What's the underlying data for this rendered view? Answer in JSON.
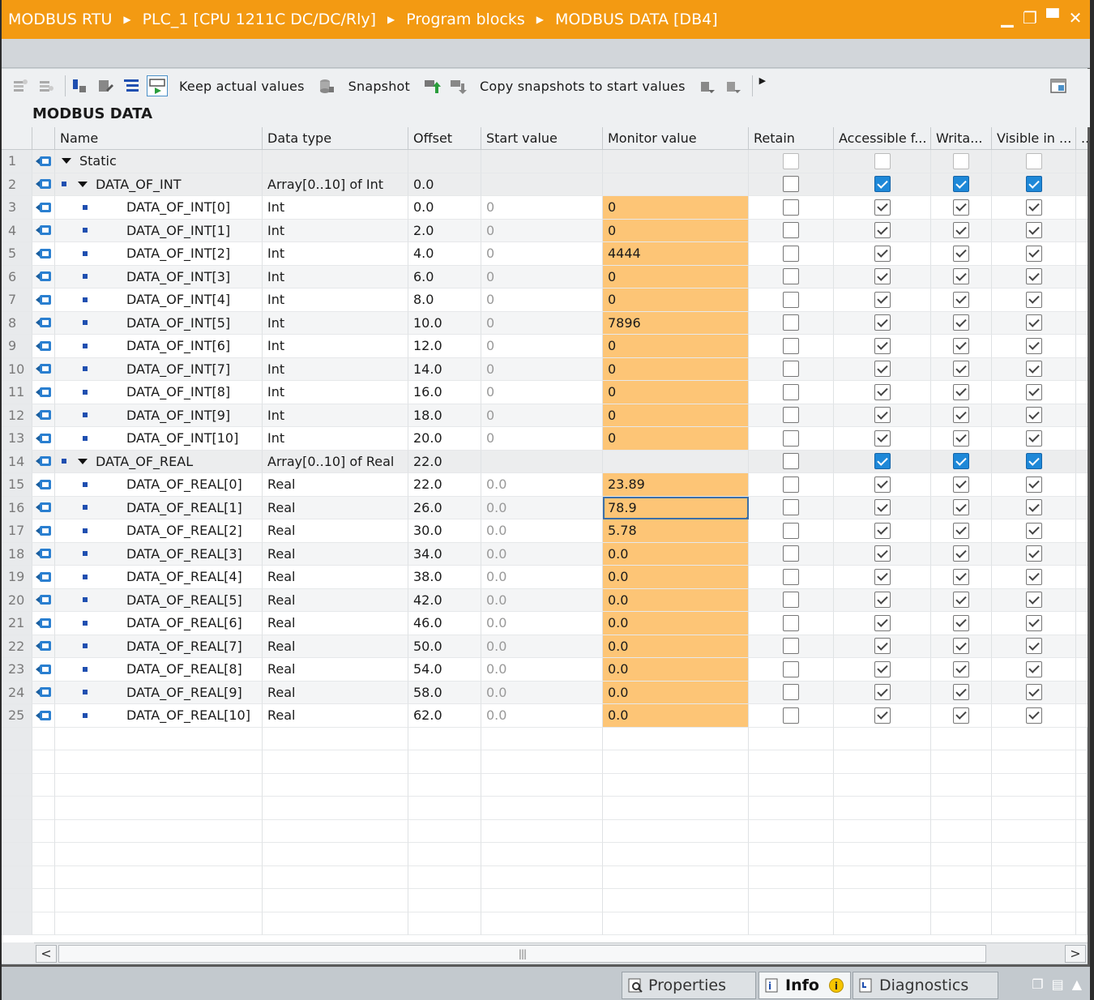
{
  "titlebar": {
    "crumbs": [
      "MODBUS RTU",
      "PLC_1 [CPU 1211C DC/DC/Rly]",
      "Program blocks",
      "MODBUS DATA [DB4]"
    ]
  },
  "toolbar": {
    "keep_actual": "Keep actual values",
    "snapshot": "Snapshot",
    "copy_snapshots": "Copy snapshots to start values"
  },
  "block_title": "MODBUS DATA",
  "columns": [
    "Name",
    "Data type",
    "Offset",
    "Start value",
    "Monitor value",
    "Retain",
    "Accessible f...",
    "Writa...",
    "Visible in ..."
  ],
  "rows": [
    {
      "n": "1",
      "name": "Static",
      "type": "",
      "offset": "",
      "start": "",
      "monitor": ""
    },
    {
      "n": "2",
      "name": "DATA_OF_INT",
      "type": "Array[0..10] of Int",
      "offset": "0.0",
      "start": "",
      "monitor": ""
    },
    {
      "n": "3",
      "name": "DATA_OF_INT[0]",
      "type": "Int",
      "offset": "0.0",
      "start": "0",
      "monitor": "0"
    },
    {
      "n": "4",
      "name": "DATA_OF_INT[1]",
      "type": "Int",
      "offset": "2.0",
      "start": "0",
      "monitor": "0"
    },
    {
      "n": "5",
      "name": "DATA_OF_INT[2]",
      "type": "Int",
      "offset": "4.0",
      "start": "0",
      "monitor": "4444"
    },
    {
      "n": "6",
      "name": "DATA_OF_INT[3]",
      "type": "Int",
      "offset": "6.0",
      "start": "0",
      "monitor": "0"
    },
    {
      "n": "7",
      "name": "DATA_OF_INT[4]",
      "type": "Int",
      "offset": "8.0",
      "start": "0",
      "monitor": "0"
    },
    {
      "n": "8",
      "name": "DATA_OF_INT[5]",
      "type": "Int",
      "offset": "10.0",
      "start": "0",
      "monitor": "7896"
    },
    {
      "n": "9",
      "name": "DATA_OF_INT[6]",
      "type": "Int",
      "offset": "12.0",
      "start": "0",
      "monitor": "0"
    },
    {
      "n": "10",
      "name": "DATA_OF_INT[7]",
      "type": "Int",
      "offset": "14.0",
      "start": "0",
      "monitor": "0"
    },
    {
      "n": "11",
      "name": "DATA_OF_INT[8]",
      "type": "Int",
      "offset": "16.0",
      "start": "0",
      "monitor": "0"
    },
    {
      "n": "12",
      "name": "DATA_OF_INT[9]",
      "type": "Int",
      "offset": "18.0",
      "start": "0",
      "monitor": "0"
    },
    {
      "n": "13",
      "name": "DATA_OF_INT[10]",
      "type": "Int",
      "offset": "20.0",
      "start": "0",
      "monitor": "0"
    },
    {
      "n": "14",
      "name": "DATA_OF_REAL",
      "type": "Array[0..10] of Real",
      "offset": "22.0",
      "start": "",
      "monitor": ""
    },
    {
      "n": "15",
      "name": "DATA_OF_REAL[0]",
      "type": "Real",
      "offset": "22.0",
      "start": "0.0",
      "monitor": "23.89"
    },
    {
      "n": "16",
      "name": "DATA_OF_REAL[1]",
      "type": "Real",
      "offset": "26.0",
      "start": "0.0",
      "monitor": "78.9"
    },
    {
      "n": "17",
      "name": "DATA_OF_REAL[2]",
      "type": "Real",
      "offset": "30.0",
      "start": "0.0",
      "monitor": "5.78"
    },
    {
      "n": "18",
      "name": "DATA_OF_REAL[3]",
      "type": "Real",
      "offset": "34.0",
      "start": "0.0",
      "monitor": "0.0"
    },
    {
      "n": "19",
      "name": "DATA_OF_REAL[4]",
      "type": "Real",
      "offset": "38.0",
      "start": "0.0",
      "monitor": "0.0"
    },
    {
      "n": "20",
      "name": "DATA_OF_REAL[5]",
      "type": "Real",
      "offset": "42.0",
      "start": "0.0",
      "monitor": "0.0"
    },
    {
      "n": "21",
      "name": "DATA_OF_REAL[6]",
      "type": "Real",
      "offset": "46.0",
      "start": "0.0",
      "monitor": "0.0"
    },
    {
      "n": "22",
      "name": "DATA_OF_REAL[7]",
      "type": "Real",
      "offset": "50.0",
      "start": "0.0",
      "monitor": "0.0"
    },
    {
      "n": "23",
      "name": "DATA_OF_REAL[8]",
      "type": "Real",
      "offset": "54.0",
      "start": "0.0",
      "monitor": "0.0"
    },
    {
      "n": "24",
      "name": "DATA_OF_REAL[9]",
      "type": "Real",
      "offset": "58.0",
      "start": "0.0",
      "monitor": "0.0"
    },
    {
      "n": "25",
      "name": "DATA_OF_REAL[10]",
      "type": "Real",
      "offset": "62.0",
      "start": "0.0",
      "monitor": "0.0"
    }
  ],
  "bottom_tabs": {
    "properties": "Properties",
    "info": "Info",
    "info_badge": "i",
    "diagnostics": "Diagnostics"
  },
  "colors": {
    "accent": "#f39a12",
    "monitor_highlight": "#fdc576",
    "checkbox_blue": "#1e88d8"
  }
}
